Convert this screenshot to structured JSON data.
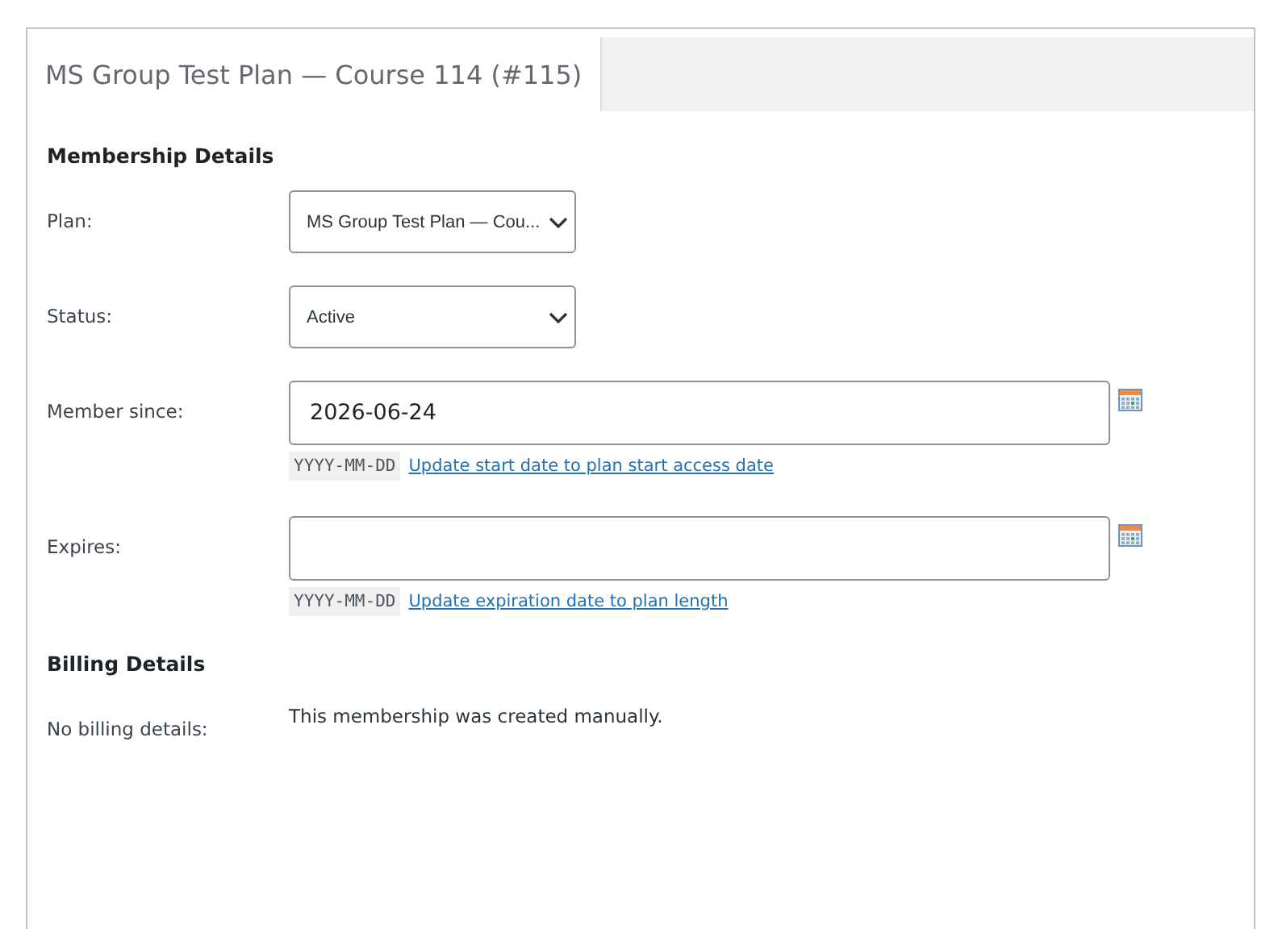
{
  "tabs": [
    {
      "label": "MS Group Test Plan — Course 114 (#115)",
      "selected": true
    }
  ],
  "sections": [
    {
      "heading": "Membership Details",
      "fields": [
        {
          "kind": "select",
          "label": "Plan:",
          "value": "MS Group Test Plan — Cou..."
        },
        {
          "kind": "select",
          "label": "Status:",
          "value": "Active"
        },
        {
          "kind": "date",
          "label": "Member since:",
          "value": "2026-06-24",
          "format": "YYYY-MM-DD",
          "link": "Update start date to plan start access date"
        },
        {
          "kind": "date",
          "label": "Expires:",
          "format": "YYYY-MM-DD",
          "link": "Update expiration date to plan length"
        }
      ]
    },
    {
      "heading": "Billing Details",
      "fields": [
        {
          "kind": "text",
          "label": "No billing details:",
          "value": "This membership was created manually."
        }
      ]
    }
  ]
}
